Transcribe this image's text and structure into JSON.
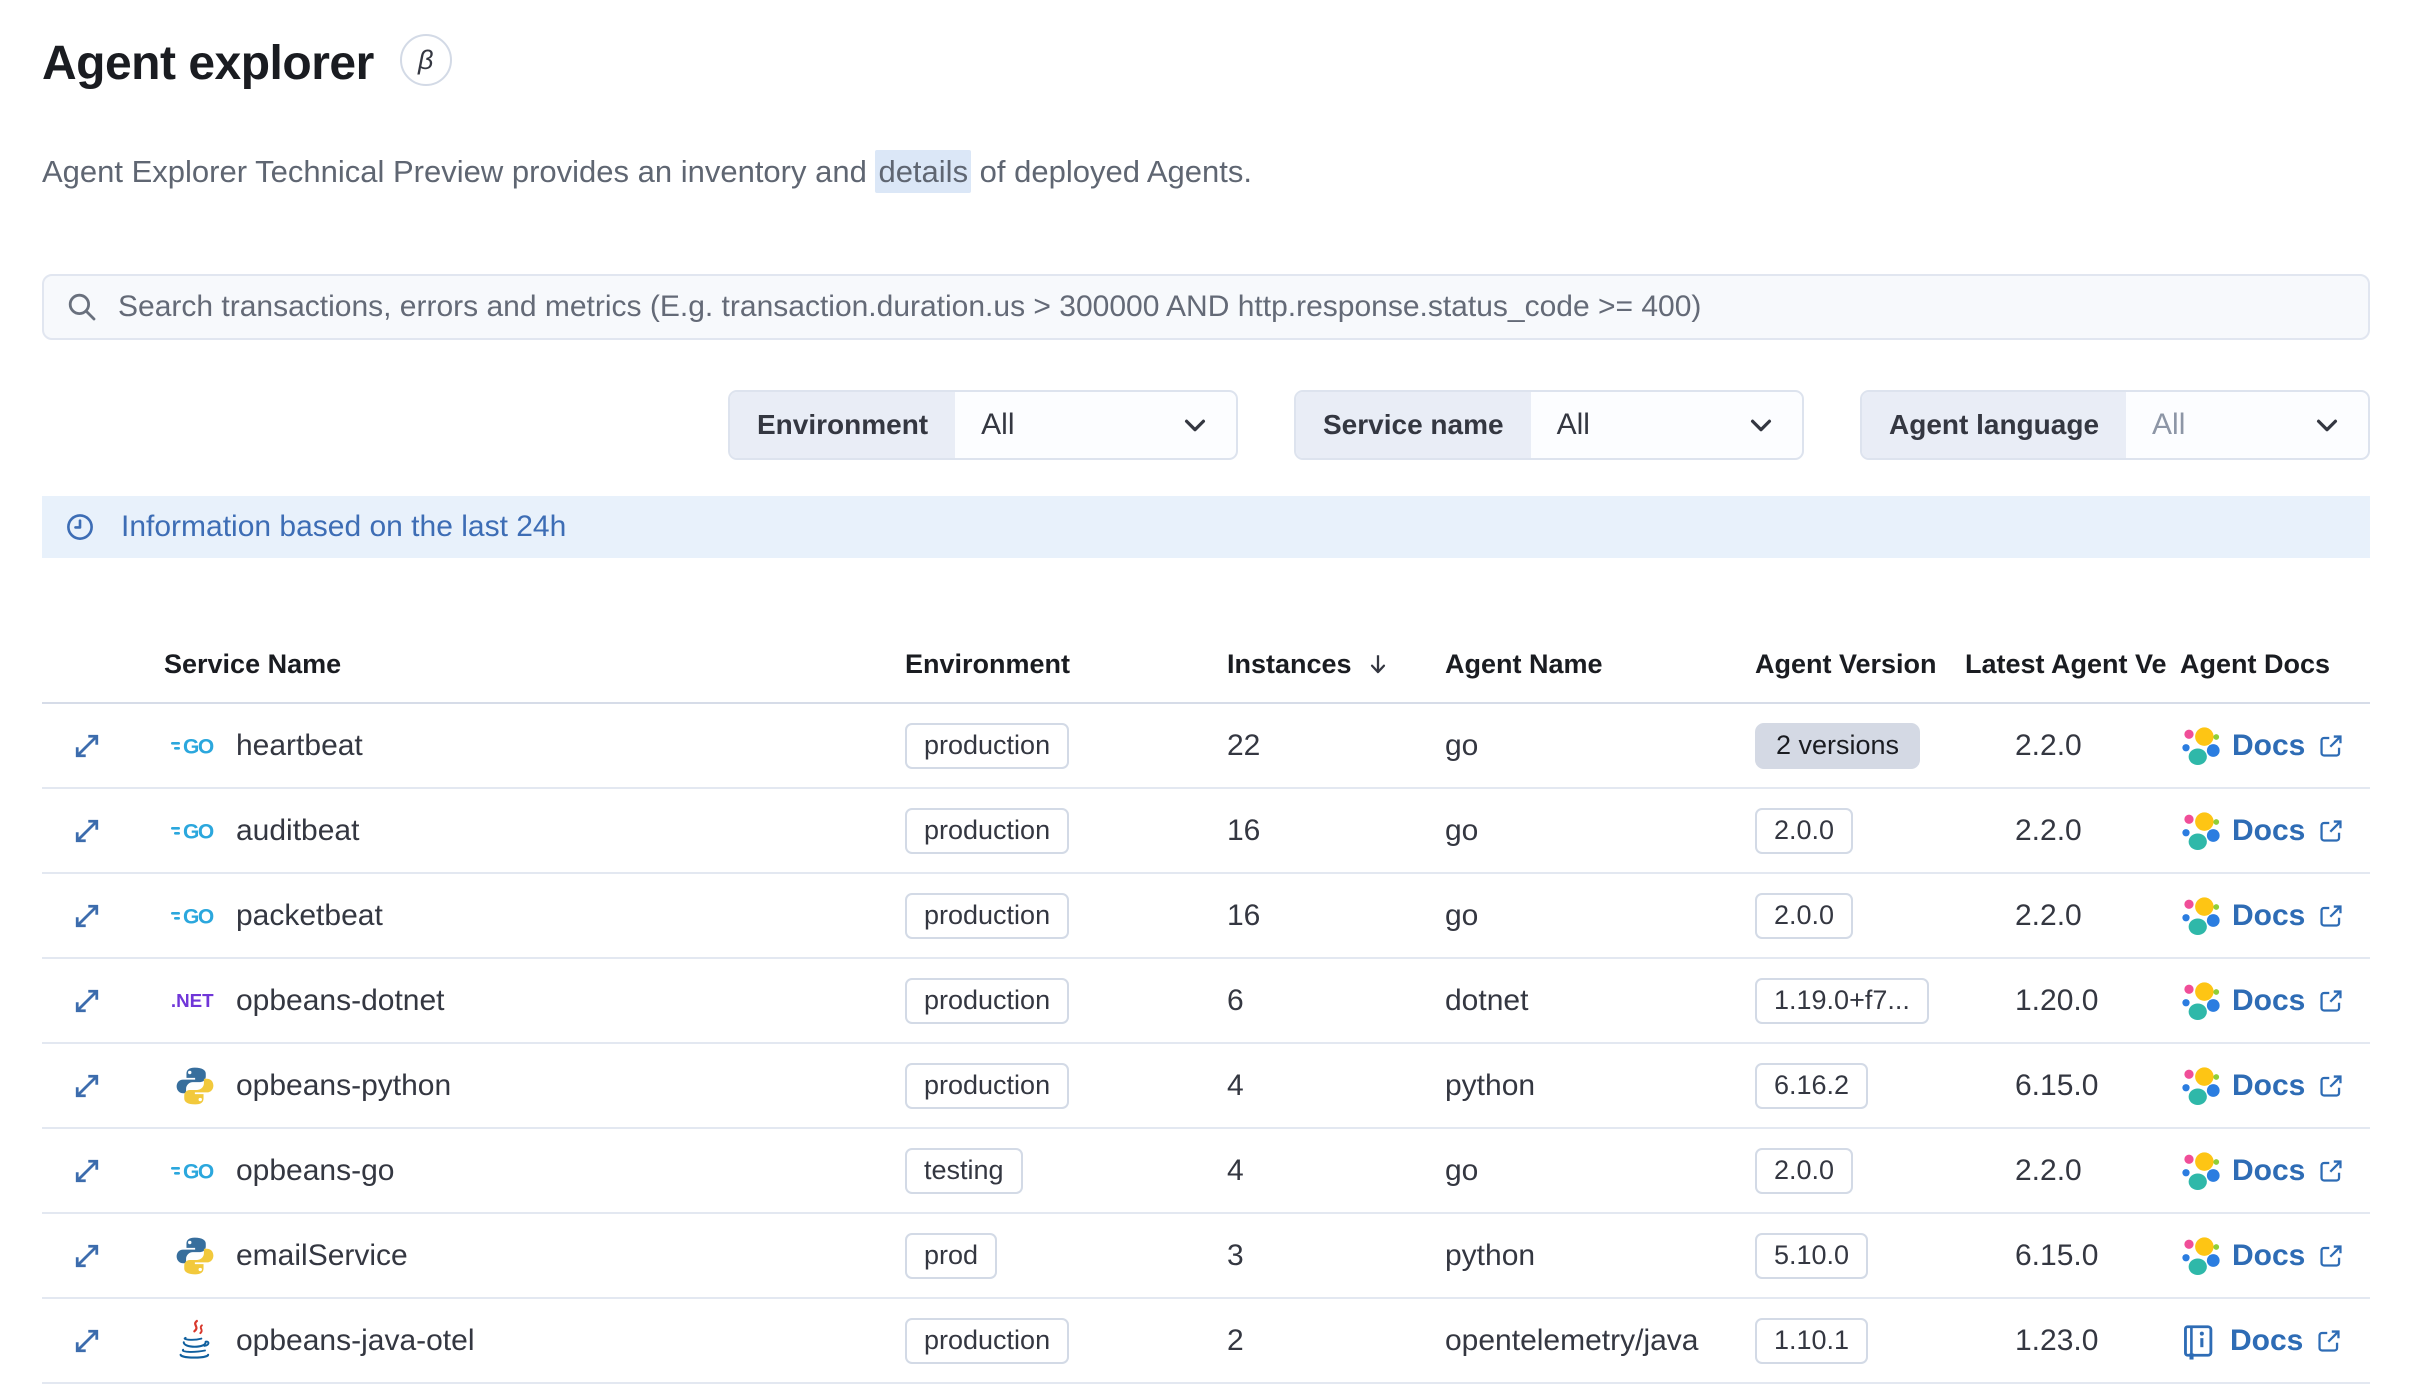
{
  "page": {
    "title": "Agent explorer",
    "beta_badge": "β",
    "subtitle": {
      "pre": "Agent Explorer Technical Preview provides an inventory and ",
      "highlight": "details",
      "post": " of deployed Agents."
    }
  },
  "search": {
    "icon": "search-icon",
    "placeholder": "Search transactions, errors and metrics (E.g. transaction.duration.us > 300000 AND http.response.status_code >= 400)"
  },
  "filters": {
    "environment": {
      "label": "Environment",
      "value": "All"
    },
    "service_name": {
      "label": "Service name",
      "value": "All"
    },
    "agent_language": {
      "label": "Agent language",
      "value": "All"
    }
  },
  "banner": {
    "icon": "clock-icon",
    "text": "Information based on the last 24h"
  },
  "table": {
    "headers": {
      "service_name": "Service Name",
      "environment": "Environment",
      "instances": "Instances",
      "agent_name": "Agent Name",
      "agent_version": "Agent Version",
      "latest_agent_version": "Latest Agent Ve",
      "agent_docs": "Agent Docs"
    },
    "sort": {
      "column": "Instances",
      "direction": "desc"
    },
    "rows": [
      {
        "service": "heartbeat",
        "service_icon": "go-icon",
        "environment": "production",
        "instances": "22",
        "agent_name": "go",
        "agent_version": "2 versions",
        "version_badge": "multiple",
        "latest_version": "2.2.0",
        "docs_label": "Docs",
        "docs_icon": "elastic-logo-icon"
      },
      {
        "service": "auditbeat",
        "service_icon": "go-icon",
        "environment": "production",
        "instances": "16",
        "agent_name": "go",
        "agent_version": "2.0.0",
        "version_badge": "single",
        "latest_version": "2.2.0",
        "docs_label": "Docs",
        "docs_icon": "elastic-logo-icon"
      },
      {
        "service": "packetbeat",
        "service_icon": "go-icon",
        "environment": "production",
        "instances": "16",
        "agent_name": "go",
        "agent_version": "2.0.0",
        "version_badge": "single",
        "latest_version": "2.2.0",
        "docs_label": "Docs",
        "docs_icon": "elastic-logo-icon"
      },
      {
        "service": "opbeans-dotnet",
        "service_icon": "dotnet-icon",
        "environment": "production",
        "instances": "6",
        "agent_name": "dotnet",
        "agent_version": "1.19.0+f7...",
        "version_badge": "single",
        "latest_version": "1.20.0",
        "docs_label": "Docs",
        "docs_icon": "elastic-logo-icon"
      },
      {
        "service": "opbeans-python",
        "service_icon": "python-icon",
        "environment": "production",
        "instances": "4",
        "agent_name": "python",
        "agent_version": "6.16.2",
        "version_badge": "single",
        "latest_version": "6.15.0",
        "docs_label": "Docs",
        "docs_icon": "elastic-logo-icon"
      },
      {
        "service": "opbeans-go",
        "service_icon": "go-icon",
        "environment": "testing",
        "instances": "4",
        "agent_name": "go",
        "agent_version": "2.0.0",
        "version_badge": "single",
        "latest_version": "2.2.0",
        "docs_label": "Docs",
        "docs_icon": "elastic-logo-icon"
      },
      {
        "service": "emailService",
        "service_icon": "python-icon",
        "environment": "prod",
        "instances": "3",
        "agent_name": "python",
        "agent_version": "5.10.0",
        "version_badge": "single",
        "latest_version": "6.15.0",
        "docs_label": "Docs",
        "docs_icon": "elastic-logo-icon"
      },
      {
        "service": "opbeans-java-otel",
        "service_icon": "java-icon",
        "environment": "production",
        "instances": "2",
        "agent_name": "opentelemetry/java",
        "agent_version": "1.10.1",
        "version_badge": "single",
        "latest_version": "1.23.0",
        "docs_label": "Docs",
        "docs_icon": "book-docs-icon"
      }
    ]
  },
  "icons": [
    "search-icon",
    "chevron-down-icon",
    "clock-icon",
    "sort-desc-icon",
    "expand-icon",
    "external-link-icon",
    "go-icon",
    "python-icon",
    "dotnet-icon",
    "java-icon",
    "elastic-logo-icon",
    "book-docs-icon"
  ],
  "colors": {
    "link_blue": "#2e6cb5",
    "banner_bg": "#e8f1fb",
    "banner_text": "#3d6db5",
    "badge_border": "#d3dae6",
    "versions_badge_bg": "#d4d9e4",
    "highlight_bg": "#dbe7f7",
    "filter_label_bg": "#e9edf6",
    "go_blue": "#2ba7dd",
    "dotnet_purple": "#7036d8",
    "python_blue": "#376e9d",
    "python_yellow": "#f2c93c",
    "java_red": "#d8382c",
    "java_blue": "#0f5f9e",
    "elastic_yellow": "#fec514",
    "elastic_pink": "#f04e98",
    "elastic_blue": "#2b7de0",
    "elastic_teal": "#2fb8a9"
  }
}
